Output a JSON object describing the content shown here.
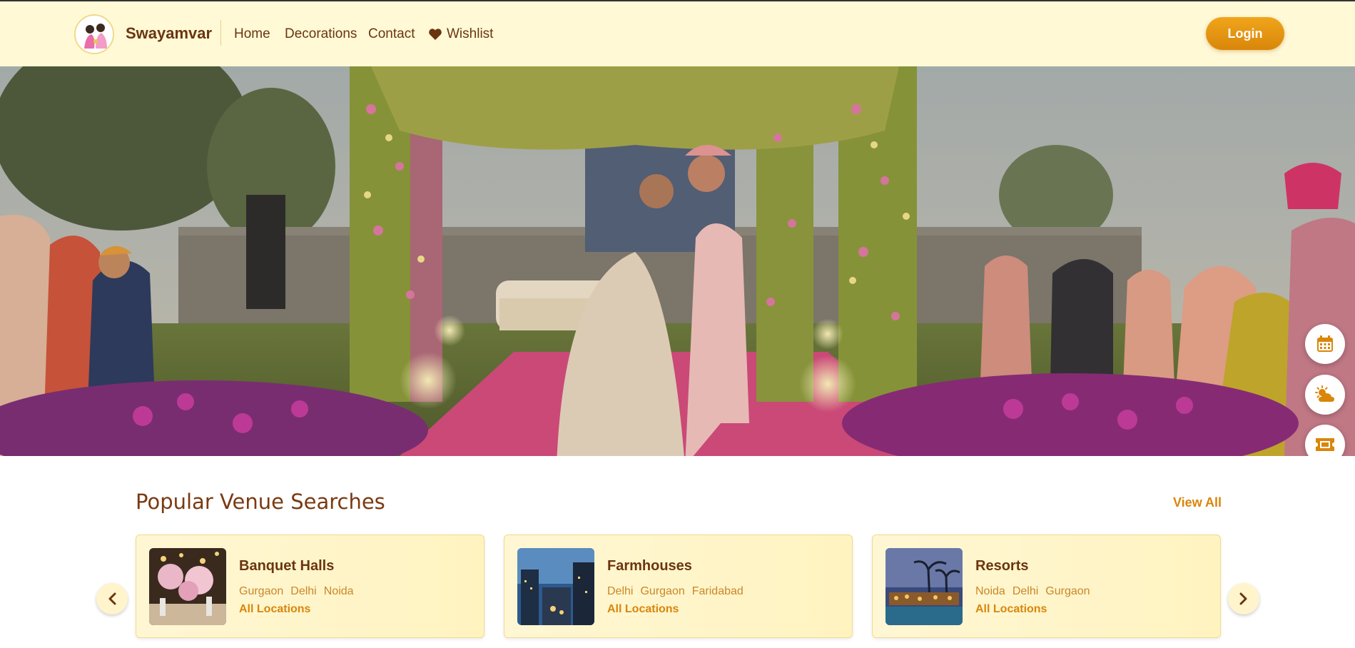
{
  "navbar": {
    "brand": "Swayamvar",
    "links": {
      "home": "Home",
      "decorations": "Decorations",
      "contact": "Contact",
      "wishlist": "Wishlist"
    },
    "login_label": "Login"
  },
  "floating_actions": [
    "calendar-icon",
    "weather-icon",
    "ticket-icon"
  ],
  "section": {
    "title": "Popular Venue Searches",
    "view_all": "View All"
  },
  "cards": [
    {
      "title": "Banquet Halls",
      "locations": [
        "Gurgaon",
        "Delhi",
        "Noida"
      ],
      "all_label": "All Locations"
    },
    {
      "title": "Farmhouses",
      "locations": [
        "Delhi",
        "Gurgaon",
        "Faridabad"
      ],
      "all_label": "All Locations"
    },
    {
      "title": "Resorts",
      "locations": [
        "Noida",
        "Delhi",
        "Gurgaon"
      ],
      "all_label": "All Locations"
    }
  ],
  "colors": {
    "navbar_bg": "#fff9d6",
    "brand_brown": "#6b3510",
    "accent": "#d9860a"
  }
}
